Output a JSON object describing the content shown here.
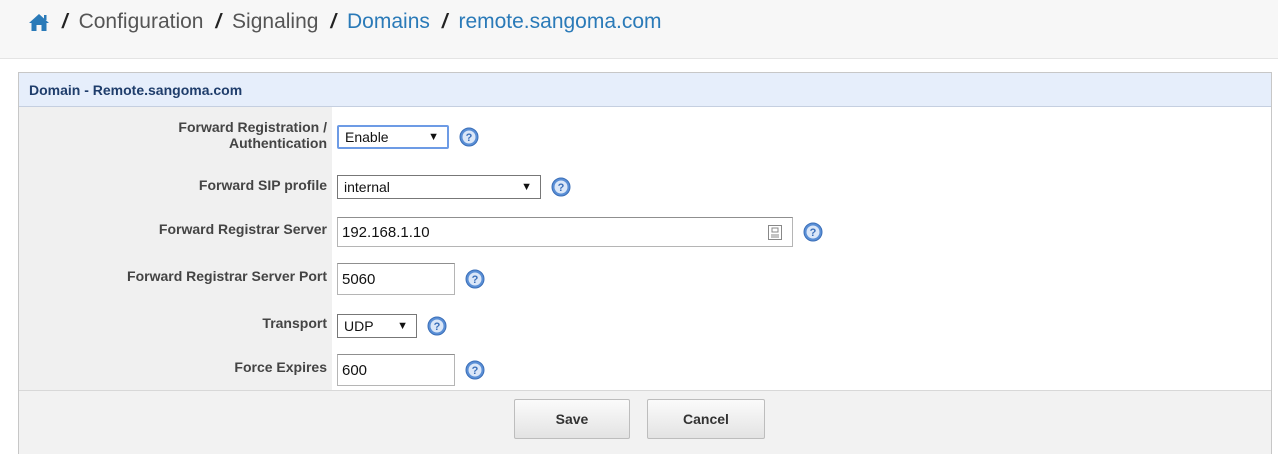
{
  "breadcrumb": {
    "items": [
      "Configuration",
      "Signaling",
      "Domains",
      "remote.sangoma.com"
    ]
  },
  "panel": {
    "title": "Domain - Remote.sangoma.com"
  },
  "form": {
    "forward_registration": {
      "label_line1": "Forward Registration /",
      "label_line2": "Authentication",
      "value": "Enable"
    },
    "forward_sip_profile": {
      "label": "Forward SIP profile",
      "value": "internal"
    },
    "forward_registrar_server": {
      "label": "Forward Registrar Server",
      "value": "192.168.1.10"
    },
    "forward_registrar_server_port": {
      "label": "Forward Registrar Server Port",
      "value": "5060"
    },
    "transport": {
      "label": "Transport",
      "value": "UDP"
    },
    "force_expires": {
      "label": "Force Expires",
      "value": "600"
    }
  },
  "buttons": {
    "save": "Save",
    "cancel": "Cancel"
  },
  "colors": {
    "link": "#2a7ab8",
    "panel_header_bg": "#e6eefb",
    "help_icon": "#5a8fd6"
  }
}
